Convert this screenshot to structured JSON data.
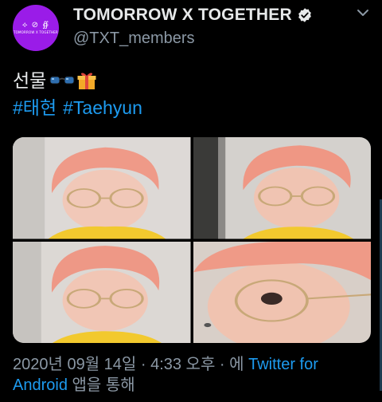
{
  "profile": {
    "avatar_symbols": "⟡ ⊘ ∯",
    "avatar_text": "TOMORROW X TOGETHER",
    "display_name": "TOMORROW X TOGETHER",
    "handle": "@TXT_members",
    "verified": true
  },
  "tweet": {
    "text": "선물",
    "emojis": [
      "glasses-emoji",
      "gift-emoji"
    ],
    "hashtags": [
      "#태현",
      "#Taehyun"
    ]
  },
  "media": {
    "count": 4,
    "items": [
      "photo-1",
      "photo-2",
      "photo-3",
      "photo-4"
    ]
  },
  "meta": {
    "timestamp": "2020년 09월 14일 · 4:33 오후 · 에 ",
    "source": "Twitter for Android",
    "suffix": " 앱을 통해"
  },
  "colors": {
    "background": "#000000",
    "link": "#1d9bf0",
    "secondary_text": "#8b98a5",
    "avatar_bg": "#9a1ce8"
  }
}
